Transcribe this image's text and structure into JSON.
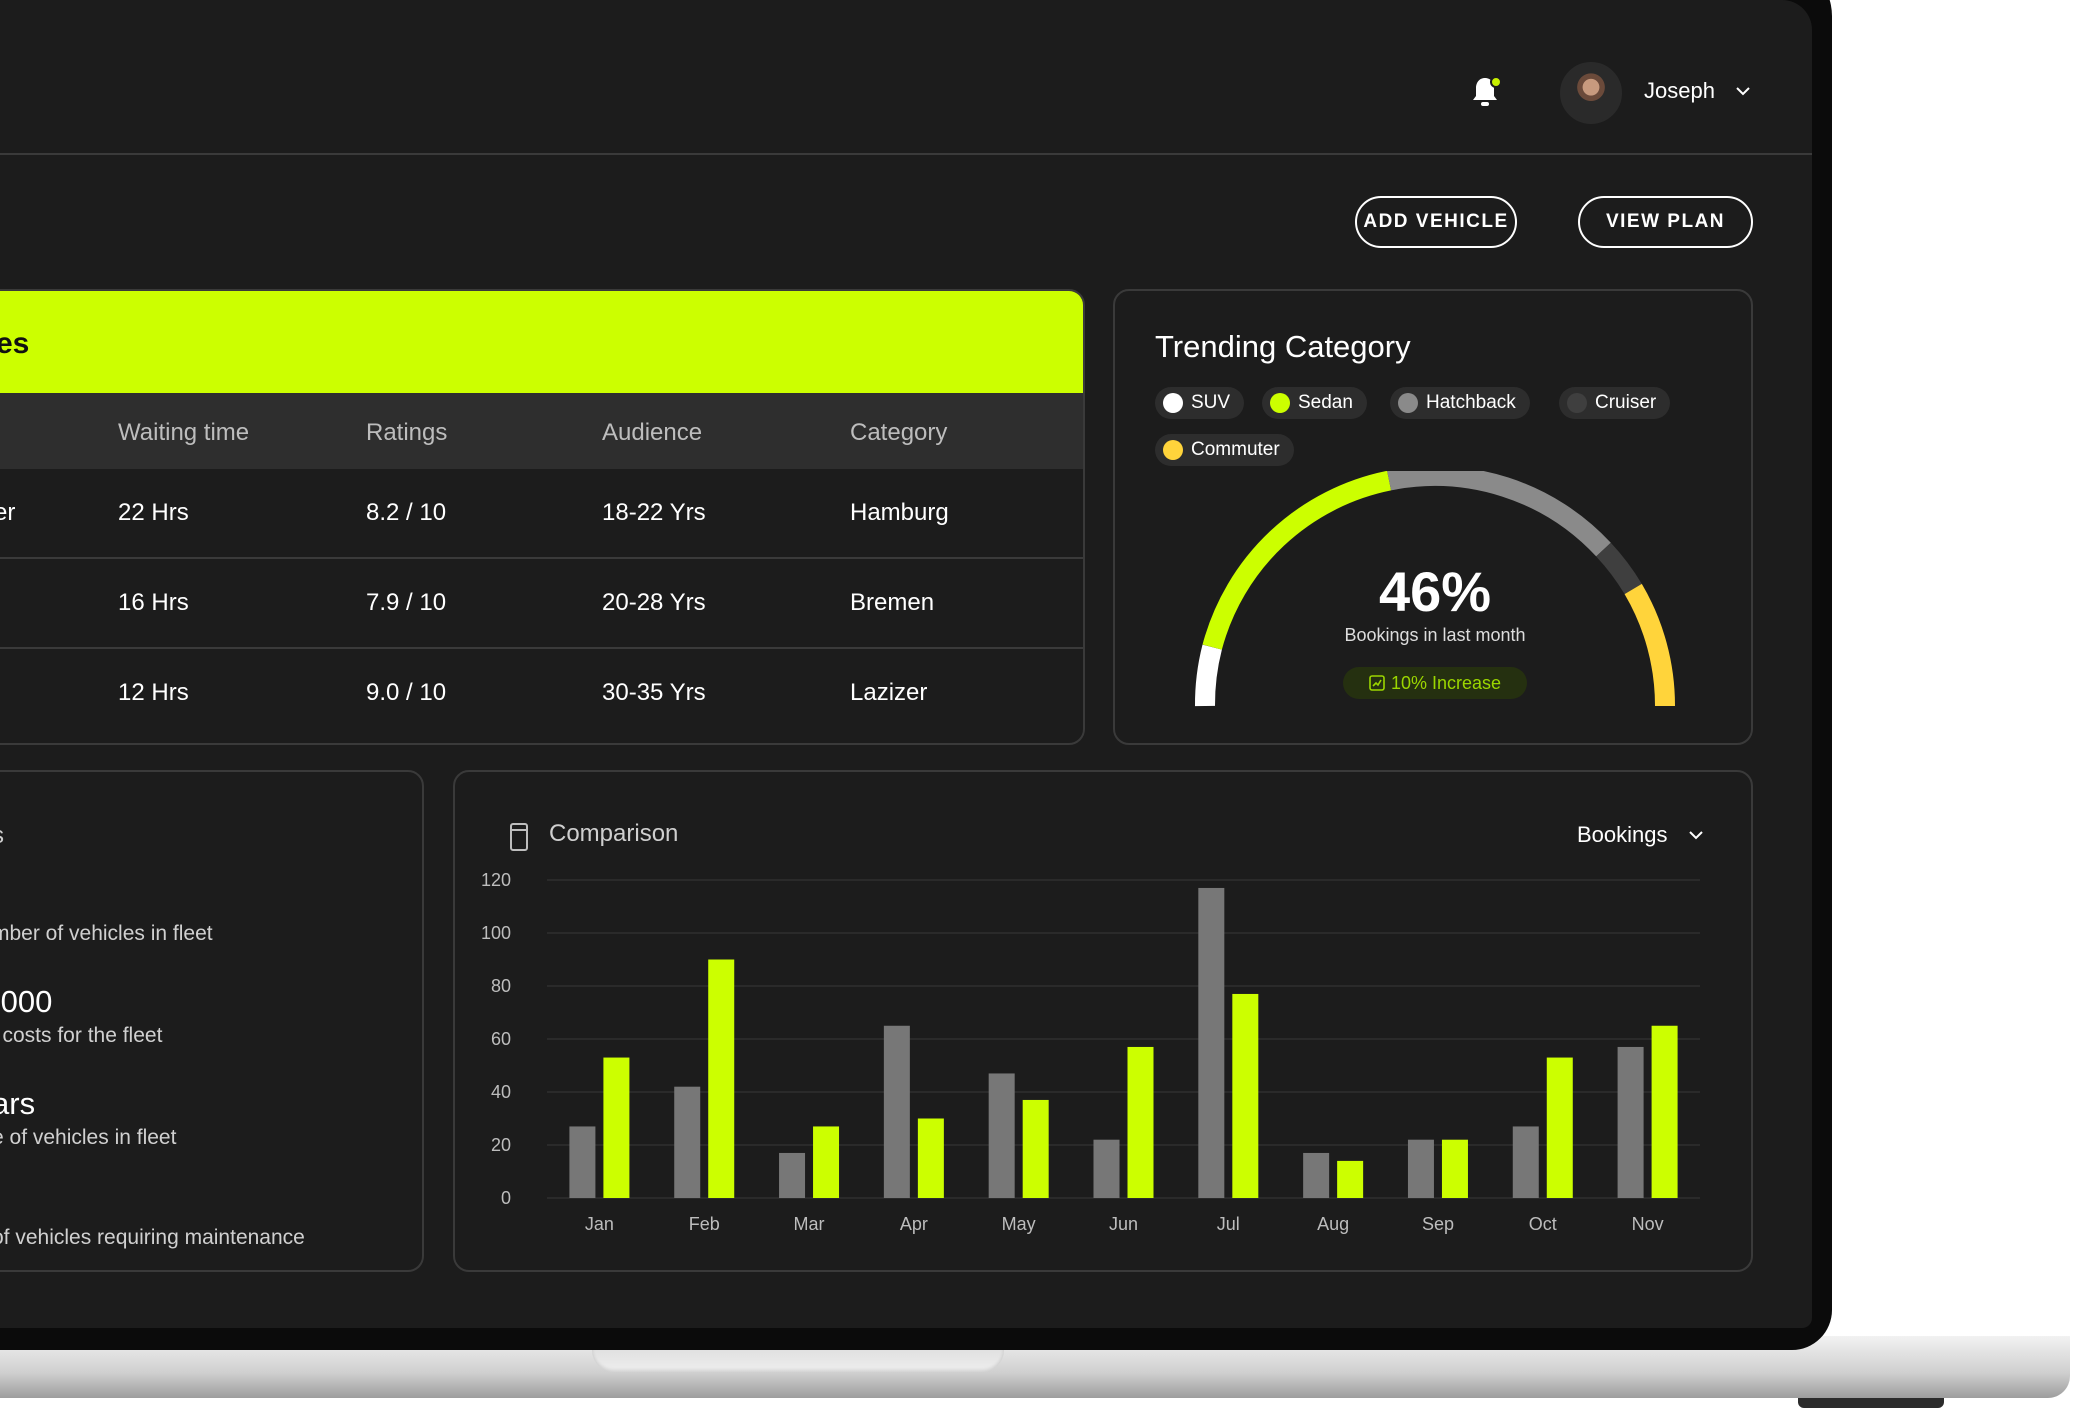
{
  "header": {
    "user_name": "Joseph"
  },
  "actions": {
    "add_vehicle": "ADD VEHICLE",
    "view_plan": "VIEW PLAN"
  },
  "vehicle_table": {
    "title": "es",
    "columns": [
      "Waiting time",
      "Ratings",
      "Audience",
      "Category"
    ],
    "rows": [
      {
        "name": "cer",
        "waiting": "22 Hrs",
        "rating": "8.2 / 10",
        "audience": "18-22 Yrs",
        "category": "Hamburg"
      },
      {
        "name": "",
        "waiting": "16 Hrs",
        "rating": "7.9 / 10",
        "audience": "20-28 Yrs",
        "category": "Bremen"
      },
      {
        "name": "",
        "waiting": "12 Hrs",
        "rating": "9.0 / 10",
        "audience": "30-35 Yrs",
        "category": "Lazizer"
      }
    ]
  },
  "trending": {
    "title": "Trending Category",
    "categories": [
      {
        "label": "SUV",
        "color": "#ffffff"
      },
      {
        "label": "Sedan",
        "color": "#ccff00"
      },
      {
        "label": "Hatchback",
        "color": "#8a8a8a"
      },
      {
        "label": "Cruiser",
        "color": "#3f3f3f"
      },
      {
        "label": "Commuter",
        "color": "#ffd43b"
      }
    ],
    "value": "46%",
    "caption": "Bookings in last month",
    "increase": "10% Increase"
  },
  "fleet_metrics": {
    "title": "s",
    "line1": "mber of vehicles in fleet",
    "value2": ",000",
    "line2": "l costs for the fleet",
    "value3": "ars",
    "line3": "e of vehicles in fleet",
    "line4": " of vehicles requiring maintenance"
  },
  "comparison": {
    "title": "Comparison",
    "selector": "Bookings"
  },
  "chart_data": {
    "type": "bar",
    "categories": [
      "Jan",
      "Feb",
      "Mar",
      "Apr",
      "May",
      "Jun",
      "Jul",
      "Aug",
      "Sep",
      "Oct",
      "Nov"
    ],
    "series": [
      {
        "color": "#777777",
        "values": [
          27,
          42,
          17,
          65,
          47,
          22,
          117,
          17,
          22,
          27,
          57
        ]
      },
      {
        "color": "#ccff00",
        "values": [
          53,
          90,
          27,
          30,
          37,
          57,
          77,
          14,
          22,
          53,
          65
        ]
      }
    ],
    "yticks": [
      0,
      20,
      40,
      60,
      80,
      100,
      120
    ],
    "ylim": [
      0,
      120
    ],
    "grid": true
  }
}
